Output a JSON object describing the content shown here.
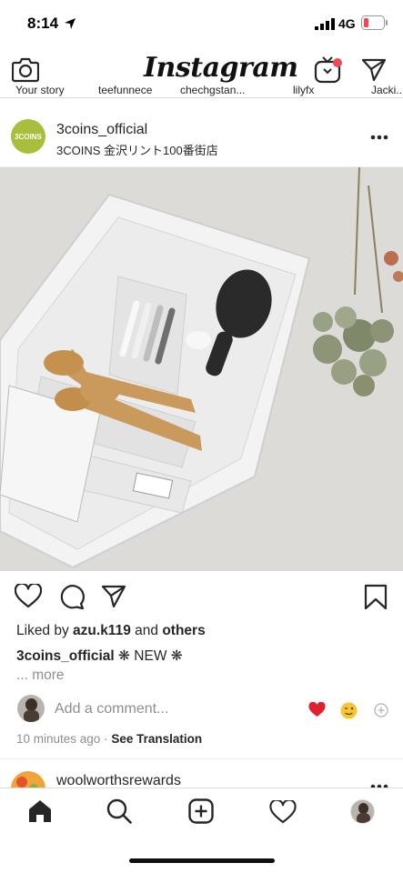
{
  "status_bar": {
    "time": "8:14",
    "network": "4G"
  },
  "header": {
    "app_title": "Instagram"
  },
  "stories": {
    "labels": [
      "Your story",
      "teefunnece",
      "chechgstan...",
      "lilyfx",
      "Jacki..."
    ]
  },
  "post": {
    "username": "3coins_official",
    "avatar_text": "3COINS",
    "location": "3COINS 金沢リント100番街店",
    "liked_prefix": "Liked by",
    "liked_user": "azu.k119",
    "liked_and": "and",
    "liked_others": "others",
    "caption_user": "3coins_official",
    "caption_text": "❋ NEW ❋",
    "more": "... more",
    "comment_placeholder": "Add a comment...",
    "time_ago": "10 minutes ago",
    "separator": "·",
    "see_translation": "See Translation"
  },
  "next_post": {
    "username": "woolworthsrewards"
  },
  "colors": {
    "accent_red": "#ed4956",
    "brand_green": "#a9bf3b"
  }
}
